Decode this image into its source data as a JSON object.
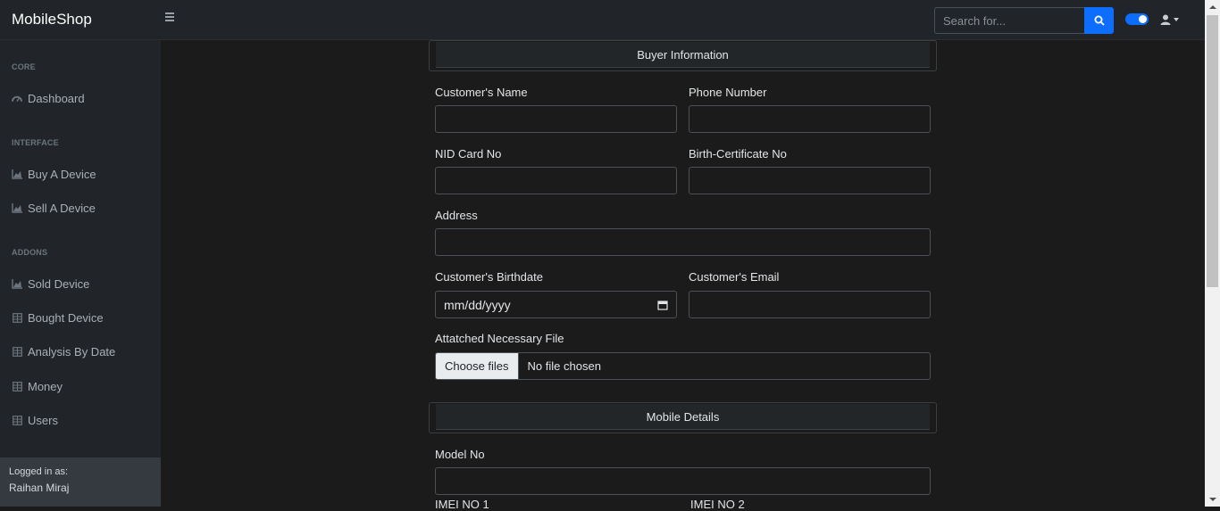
{
  "app": {
    "brand": "MobileShop"
  },
  "topbar": {
    "search_placeholder": "Search for..."
  },
  "sidebar": {
    "headings": {
      "core": "CORE",
      "interface": "INTERFACE",
      "addons": "ADDONS"
    },
    "items": [
      {
        "label": "Dashboard",
        "icon": "dashboard-icon"
      },
      {
        "label": "Buy A Device",
        "icon": "chart-area-icon"
      },
      {
        "label": "Sell A Device",
        "icon": "chart-area-icon"
      },
      {
        "label": "Sold Device",
        "icon": "chart-area-icon"
      },
      {
        "label": "Bought Device",
        "icon": "table-icon"
      },
      {
        "label": "Analysis By Date",
        "icon": "table-icon"
      },
      {
        "label": "Money",
        "icon": "table-icon"
      },
      {
        "label": "Users",
        "icon": "table-icon"
      }
    ],
    "footer": {
      "logged_in_label": "Logged in as:",
      "user_name": "Raihan Miraj"
    }
  },
  "form": {
    "buyer_section": "Buyer Information",
    "customer_name_label": "Customer's Name",
    "phone_label": "Phone Number",
    "nid_label": "NID Card No",
    "birth_cert_label": "Birth-Certificate No",
    "address_label": "Address",
    "birthdate_label": "Customer's Birthdate",
    "birthdate_placeholder": "mm/dd/yyyy",
    "email_label": "Customer's Email",
    "file_label": "Attatched Necessary File",
    "file_button": "Choose files",
    "file_status": "No file chosen",
    "mobile_section": "Mobile Details",
    "model_label": "Model No",
    "imei1_label": "IMEI NO 1",
    "imei2_label": "IMEI NO 2"
  },
  "colors": {
    "accent": "#0d6efd",
    "sidebar_bg": "#212529",
    "main_bg": "#1b1b1c"
  }
}
